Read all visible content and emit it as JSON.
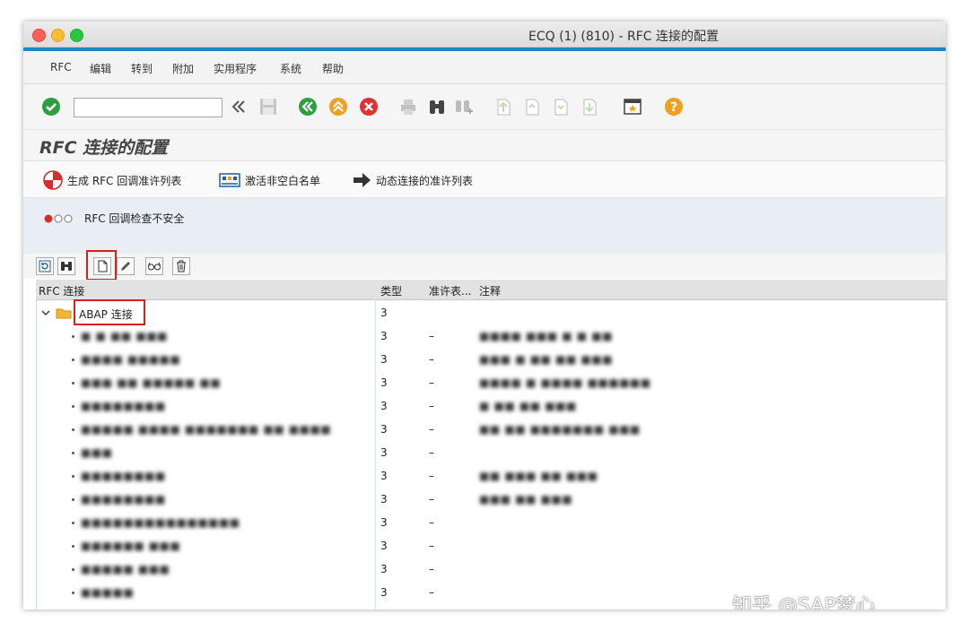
{
  "window": {
    "title": "ECQ (1) (810) - RFC 连接的配置"
  },
  "menu": [
    "RFC",
    "编辑",
    "转到",
    "附加",
    "实用程序",
    "系统",
    "帮助"
  ],
  "toolbar": {
    "command_value": "",
    "icons": [
      "enter-check-icon",
      "command-field",
      "nav-collapse-icon",
      "save-icon",
      "back-icon",
      "exit-icon",
      "cancel-icon",
      "print-icon",
      "find-icon",
      "find-next-icon",
      "first-page-icon",
      "prev-page-icon",
      "next-page-icon",
      "last-page-icon",
      "create-session-icon",
      "help-icon"
    ]
  },
  "page": {
    "title": "RFC 连接的配置"
  },
  "appbar": {
    "btn1": "生成 RFC 回调准许列表",
    "btn2": "激活非空白名单",
    "btn3": "动态连接的准许列表"
  },
  "info": {
    "message": "RFC 回调检查不安全"
  },
  "grid": {
    "headers": {
      "rfc": "RFC 连接",
      "type": "类型",
      "allow": "准许表...",
      "comment": "注释"
    },
    "group": {
      "label": "ABAP 连接",
      "type": "3"
    },
    "rows": [
      {
        "name": "■ ■ ■■ ■■■",
        "type": "3",
        "allow": "–",
        "comment": "■■■■ ■■■ ■ ■ ■■"
      },
      {
        "name": "■■■■ ■■■■■",
        "type": "3",
        "allow": "–",
        "comment": "■■■ ■ ■■ ■■ ■■■"
      },
      {
        "name": "■■■ ■■ ■■■■■ ■■",
        "type": "3",
        "allow": "–",
        "comment": "■■■■ ■ ■■■■ ■■■■■■"
      },
      {
        "name": "■■■■■■■■",
        "type": "3",
        "allow": "–",
        "comment": "■ ■■ ■■ ■■■"
      },
      {
        "name": "■■■■■ ■■■■ ■■■■■■■ ■■ ■■■■",
        "type": "3",
        "allow": "–",
        "comment": "■■ ■■ ■■■■■■■ ■■■"
      },
      {
        "name": "■■■",
        "type": "3",
        "allow": "–",
        "comment": ""
      },
      {
        "name": "■■■■■■■■",
        "type": "3",
        "allow": "–",
        "comment": "■■ ■■■ ■■ ■■■"
      },
      {
        "name": "■■■■■■■■",
        "type": "3",
        "allow": "–",
        "comment": "■■■ ■■ ■■■"
      },
      {
        "name": "■■■■■■■■■■■■■■■",
        "type": "3",
        "allow": "–",
        "comment": ""
      },
      {
        "name": "■■■■■■ ■■■",
        "type": "3",
        "allow": "–",
        "comment": ""
      },
      {
        "name": "■■■■■ ■■■",
        "type": "3",
        "allow": "–",
        "comment": ""
      },
      {
        "name": "■■■■■",
        "type": "3",
        "allow": "–",
        "comment": ""
      }
    ]
  },
  "watermark": "知乎 @SAP梦心",
  "colors": {
    "accent_blue": "#1f87c8",
    "highlight_red": "#d61f1f",
    "info_bg": "#e8eef4"
  }
}
